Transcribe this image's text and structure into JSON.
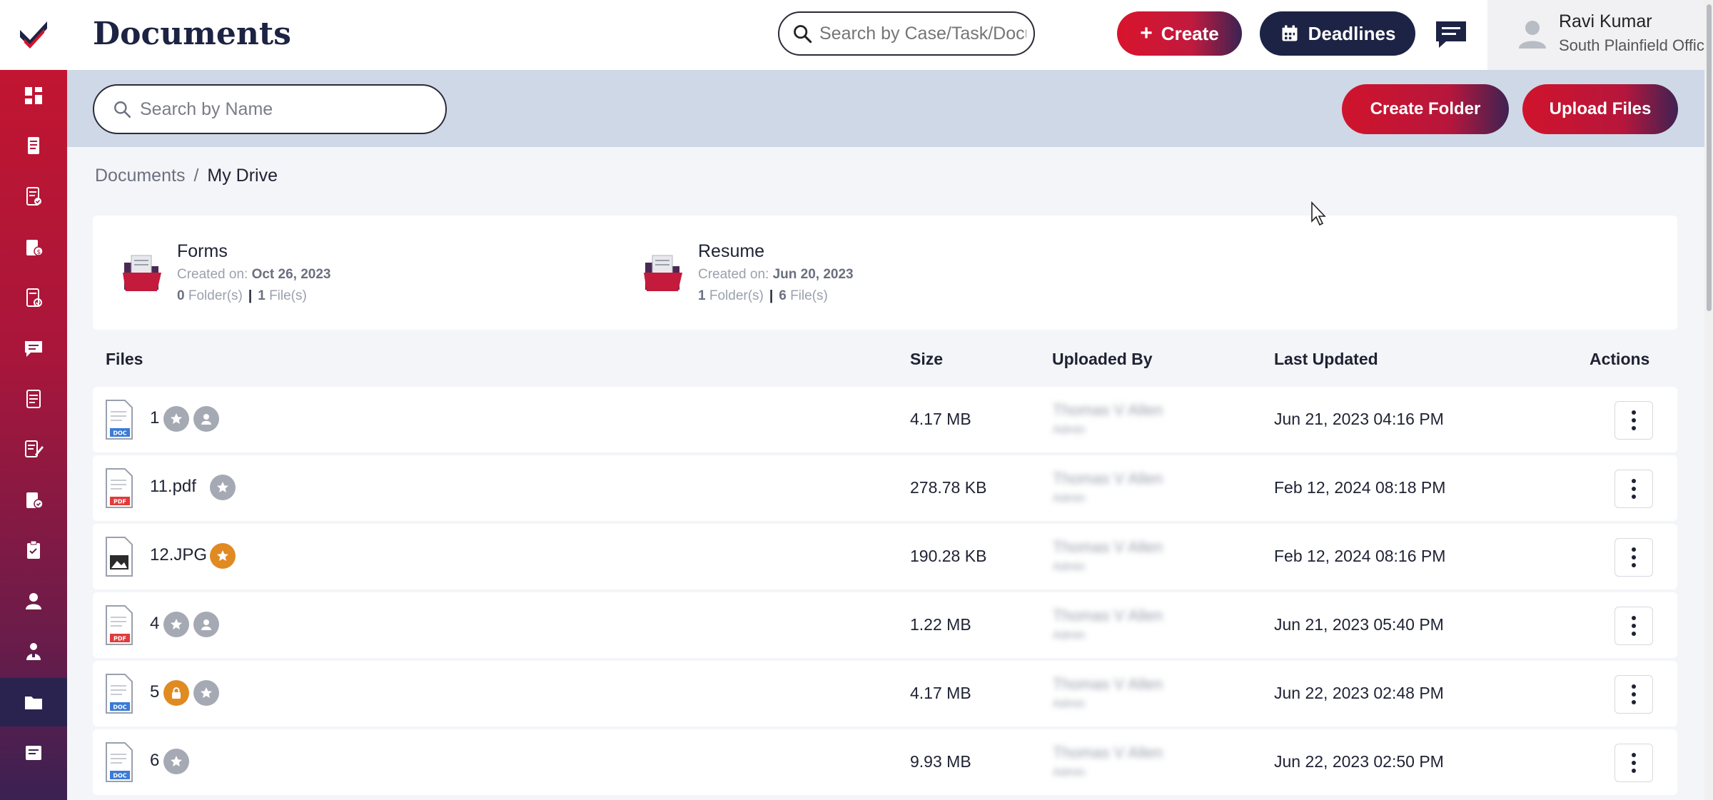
{
  "app": {
    "page_title": "Documents",
    "global_search": {
      "placeholder": "Search by Case/Task/Document"
    },
    "create_label": "Create",
    "deadlines_label": "Deadlines",
    "user": {
      "name": "Ravi Kumar",
      "office": "South Plainfield Office"
    }
  },
  "sidebar": {
    "items": [
      {
        "icon": "dashboard-icon"
      },
      {
        "icon": "cases-icon"
      },
      {
        "icon": "tasks-checklist-icon"
      },
      {
        "icon": "billing-icon"
      },
      {
        "icon": "approvals-icon"
      },
      {
        "icon": "messages-icon"
      },
      {
        "icon": "notes-icon"
      },
      {
        "icon": "edit-document-icon"
      },
      {
        "icon": "case-approval-icon"
      },
      {
        "icon": "clipboard-icon"
      },
      {
        "icon": "user-icon"
      },
      {
        "icon": "contacts-icon"
      },
      {
        "icon": "documents-folder-icon",
        "active": true
      },
      {
        "icon": "forms-icon"
      }
    ]
  },
  "toolbar": {
    "name_search_placeholder": "Search by Name",
    "create_folder_label": "Create Folder",
    "upload_files_label": "Upload Files"
  },
  "breadcrumb": {
    "root": "Documents",
    "separator": "/",
    "current": "My Drive"
  },
  "folders": [
    {
      "name": "Forms",
      "created_label": "Created on:",
      "created_on": "Oct 26, 2023",
      "folder_count": "0",
      "folder_label": "Folder(s)",
      "file_count": "1",
      "file_label": "File(s)"
    },
    {
      "name": "Resume",
      "created_label": "Created on:",
      "created_on": "Jun 20, 2023",
      "folder_count": "1",
      "folder_label": "Folder(s)",
      "file_count": "6",
      "file_label": "File(s)"
    }
  ],
  "table": {
    "headers": {
      "files": "Files",
      "size": "Size",
      "uploaded_by": "Uploaded By",
      "last_updated": "Last Updated",
      "actions": "Actions"
    },
    "rows": [
      {
        "name": "1",
        "type": "DOC",
        "size": "4.17 MB",
        "uploaded_by": "Thomas V Allen",
        "role": "Admin",
        "last_updated": "Jun 21, 2023 04:16 PM",
        "badges": [
          "star-grey",
          "user-grey"
        ]
      },
      {
        "name": "11.pdf",
        "type": "PDF",
        "size": "278.78 KB",
        "uploaded_by": "Thomas V Allen",
        "role": "Admin",
        "last_updated": "Feb 12, 2024 08:18 PM",
        "badges": [
          "star-grey"
        ]
      },
      {
        "name": "12.JPG",
        "type": "IMG",
        "size": "190.28 KB",
        "uploaded_by": "Thomas V Allen",
        "role": "Admin",
        "last_updated": "Feb 12, 2024 08:16 PM",
        "badges": [
          "star-orange"
        ]
      },
      {
        "name": "4",
        "type": "PDF",
        "size": "1.22 MB",
        "uploaded_by": "Thomas V Allen",
        "role": "Admin",
        "last_updated": "Jun 21, 2023 05:40 PM",
        "badges": [
          "star-grey",
          "user-grey"
        ]
      },
      {
        "name": "5",
        "type": "DOC",
        "size": "4.17 MB",
        "uploaded_by": "Thomas V Allen",
        "role": "Admin",
        "last_updated": "Jun 22, 2023 02:48 PM",
        "badges": [
          "lock-orange",
          "star-grey"
        ]
      },
      {
        "name": "6",
        "type": "DOC",
        "size": "9.93 MB",
        "uploaded_by": "Thomas V Allen",
        "role": "Admin",
        "last_updated": "Jun 22, 2023 02:50 PM",
        "badges": [
          "star-grey"
        ]
      }
    ]
  },
  "colors": {
    "brand_red": "#d0142c",
    "brand_navy": "#1d2344",
    "star_orange": "#e08a22",
    "badge_grey": "#a5a9b3"
  }
}
